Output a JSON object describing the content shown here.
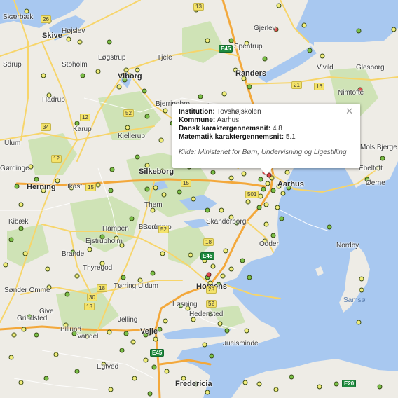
{
  "info_window": {
    "institution_label": "Institution:",
    "institution_value": "Tovshøjskolen",
    "kommune_label": "Kommune:",
    "kommune_value": "Aarhus",
    "dansk_label": "Dansk karaktergennemsnit:",
    "dansk_value": "4.8",
    "matematik_label": "Matematik karaktergennemsnit:",
    "matematik_value": "5.1",
    "source": "Kilde: Ministeriet for Børn, Undervisning og Ligestilling",
    "close_icon": "close-icon"
  },
  "colors": {
    "water": "#a8c8f0",
    "land": "#eeece6",
    "forest": "#cfe3b6",
    "motorway": "#f3a83b",
    "road": "#f7d56a",
    "marker_yellow": "#f1ed7a",
    "marker_green": "#79c046",
    "marker_red": "#e0484c",
    "marker_orange": "#f5b04a"
  },
  "places": [
    {
      "name": "Skive",
      "cls": "big"
    },
    {
      "name": "Højslev",
      "cls": ""
    },
    {
      "name": "Stoholm",
      "cls": ""
    },
    {
      "name": "Løgstrup",
      "cls": ""
    },
    {
      "name": "Tjele",
      "cls": ""
    },
    {
      "name": "Viborg",
      "cls": "big"
    },
    {
      "name": "Bjerringbro",
      "cls": ""
    },
    {
      "name": "Randers",
      "cls": "big"
    },
    {
      "name": "Spentrup",
      "cls": ""
    },
    {
      "name": "Gjerlev",
      "cls": ""
    },
    {
      "name": "Vivild",
      "cls": ""
    },
    {
      "name": "Glesborg",
      "cls": ""
    },
    {
      "name": "Nimtofte",
      "cls": ""
    },
    {
      "name": "Hadsund",
      "cls": ""
    },
    {
      "name": "Karup",
      "cls": ""
    },
    {
      "name": "Kjellerup",
      "cls": ""
    },
    {
      "name": "Silkeborg",
      "cls": "big"
    },
    {
      "name": "Herning",
      "cls": "big"
    },
    {
      "name": "Ikast",
      "cls": ""
    },
    {
      "name": "Them",
      "cls": ""
    },
    {
      "name": "Brædstrup",
      "cls": ""
    },
    {
      "name": "Skanderborg",
      "cls": ""
    },
    {
      "name": "Hampen",
      "cls": ""
    },
    {
      "name": "Ejstrupholm",
      "cls": ""
    },
    {
      "name": "Brande",
      "cls": ""
    },
    {
      "name": "Thyregod",
      "cls": ""
    },
    {
      "name": "Odder",
      "cls": ""
    },
    {
      "name": "Horsens",
      "cls": "big"
    },
    {
      "name": "Tørring Uldum",
      "cls": ""
    },
    {
      "name": "Løsning",
      "cls": ""
    },
    {
      "name": "Hedensted",
      "cls": ""
    },
    {
      "name": "Juelsminde",
      "cls": ""
    },
    {
      "name": "Jelling",
      "cls": ""
    },
    {
      "name": "Vejle",
      "cls": "big"
    },
    {
      "name": "Billund",
      "cls": ""
    },
    {
      "name": "Vandel",
      "cls": ""
    },
    {
      "name": "Give",
      "cls": ""
    },
    {
      "name": "Grindsted",
      "cls": ""
    },
    {
      "name": "Sønder Omme",
      "cls": ""
    },
    {
      "name": "Egtved",
      "cls": ""
    },
    {
      "name": "Fredericia",
      "cls": "big"
    },
    {
      "name": "Kibæk",
      "cls": ""
    },
    {
      "name": "Ebeltoft",
      "cls": ""
    },
    {
      "name": "Øerne",
      "cls": ""
    },
    {
      "name": "Nordby",
      "cls": ""
    },
    {
      "name": "Samsø",
      "cls": "sea"
    },
    {
      "name": "Aarhus",
      "cls": "big"
    },
    {
      "name": "Hammel",
      "cls": ""
    },
    {
      "name": "Hadsten",
      "cls": ""
    },
    {
      "name": "Skærbæk",
      "cls": ""
    },
    {
      "name": "Mols Bjerge",
      "cls": ""
    },
    {
      "name": "Hadrup",
      "cls": ""
    },
    {
      "name": "Ulum",
      "cls": ""
    },
    {
      "name": "Gørdinge",
      "cls": ""
    },
    {
      "name": "Borup",
      "cls": ""
    },
    {
      "name": "Sdrup",
      "cls": ""
    }
  ],
  "shields": [
    {
      "label": "26",
      "cls": "yellow"
    },
    {
      "label": "13",
      "cls": "yellow"
    },
    {
      "label": "E45",
      "cls": "green"
    },
    {
      "label": "21",
      "cls": "yellow"
    },
    {
      "label": "16",
      "cls": "yellow"
    },
    {
      "label": "12",
      "cls": "yellow"
    },
    {
      "label": "52",
      "cls": "yellow"
    },
    {
      "label": "34",
      "cls": "yellow"
    },
    {
      "label": "15",
      "cls": "yellow"
    },
    {
      "label": "15",
      "cls": "yellow"
    },
    {
      "label": "501",
      "cls": "yellow"
    },
    {
      "label": "52",
      "cls": "yellow"
    },
    {
      "label": "E45",
      "cls": "green"
    },
    {
      "label": "18",
      "cls": "yellow"
    },
    {
      "label": "13",
      "cls": "yellow"
    },
    {
      "label": "30",
      "cls": "yellow"
    },
    {
      "label": "28",
      "cls": "yellow"
    },
    {
      "label": "52",
      "cls": "yellow"
    },
    {
      "label": "E45",
      "cls": "green"
    },
    {
      "label": "18",
      "cls": "yellow"
    },
    {
      "label": "12",
      "cls": "yellow"
    },
    {
      "label": "E20",
      "cls": "green"
    }
  ]
}
